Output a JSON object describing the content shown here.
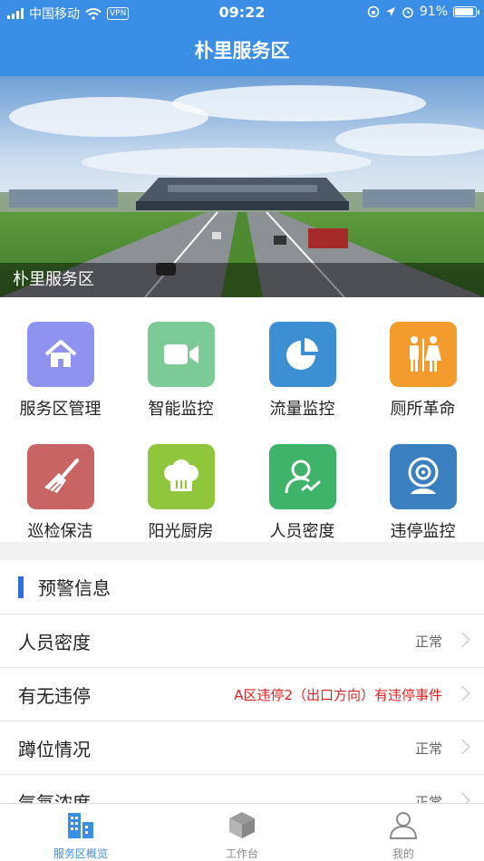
{
  "status_bar": {
    "carrier": "中国移动",
    "vpn": "VPN",
    "time": "09:22",
    "battery": "91%",
    "battery_level": 0.91
  },
  "nav": {
    "title": "朴里服务区"
  },
  "banner": {
    "caption": "朴里服务区"
  },
  "grid": {
    "items": [
      {
        "label": "服务区管理",
        "icon": "house-icon",
        "color": "#8f92ee"
      },
      {
        "label": "智能监控",
        "icon": "video-camera-icon",
        "color": "#7ccb96"
      },
      {
        "label": "流量监控",
        "icon": "pie-chart-icon",
        "color": "#3d8fd4"
      },
      {
        "label": "厕所革命",
        "icon": "restroom-icon",
        "color": "#f39b2c"
      },
      {
        "label": "巡检保洁",
        "icon": "broom-icon",
        "color": "#c96465"
      },
      {
        "label": "阳光厨房",
        "icon": "chef-hat-icon",
        "color": "#8fc63c"
      },
      {
        "label": "人员密度",
        "icon": "person-check-icon",
        "color": "#3fb36a"
      },
      {
        "label": "违停监控",
        "icon": "webcam-icon",
        "color": "#3a7fc0"
      }
    ]
  },
  "alerts": {
    "title": "预警信息",
    "rows": [
      {
        "name": "人员密度",
        "value": "正常",
        "warn": false
      },
      {
        "name": "有无违停",
        "value": "A区违停2（出口方向）有违停事件",
        "warn": true
      },
      {
        "name": "蹲位情况",
        "value": "正常",
        "warn": false
      },
      {
        "name": "气氛浓度",
        "value": "正常",
        "warn": false
      }
    ]
  },
  "tabs": [
    {
      "label": "服务区概览",
      "icon": "building-icon",
      "active": true
    },
    {
      "label": "工作台",
      "icon": "cube-icon",
      "active": false
    },
    {
      "label": "我的",
      "icon": "user-icon",
      "active": false
    }
  ]
}
